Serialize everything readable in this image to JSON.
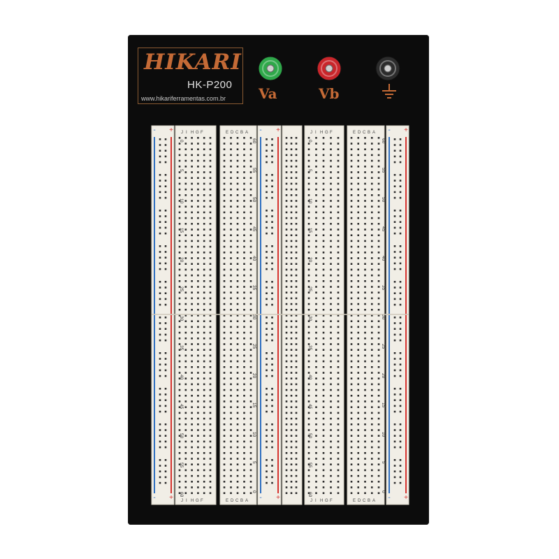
{
  "board": {
    "brand": "HIKARI",
    "model": "HK-P200",
    "website": "www.hikariferramentas.com.br",
    "colors": {
      "panel": "#0c0c0c",
      "brand": "#c46a36",
      "strip": "#f1eee6",
      "hole": "#2b2b2b",
      "positive_rail": "#d6332f",
      "negative_rail": "#2f6fc0"
    }
  },
  "terminals": [
    {
      "label": "Va",
      "color": "#2fa84a"
    },
    {
      "label": "Vb",
      "color": "#c9262b"
    },
    {
      "label": "",
      "icon": "ground-icon",
      "color": "#2c2c2c"
    }
  ],
  "rails": {
    "plus": "+",
    "minus": "-"
  },
  "strips": {
    "row_letters_left": [
      "J",
      "I",
      "H",
      "G",
      "F"
    ],
    "row_letters_right": [
      "E",
      "D",
      "C",
      "B",
      "A"
    ],
    "column_numbers": [
      "0",
      "5",
      "10",
      "15",
      "20",
      "25",
      "30",
      "35",
      "40",
      "45",
      "50",
      "55",
      "60"
    ]
  }
}
